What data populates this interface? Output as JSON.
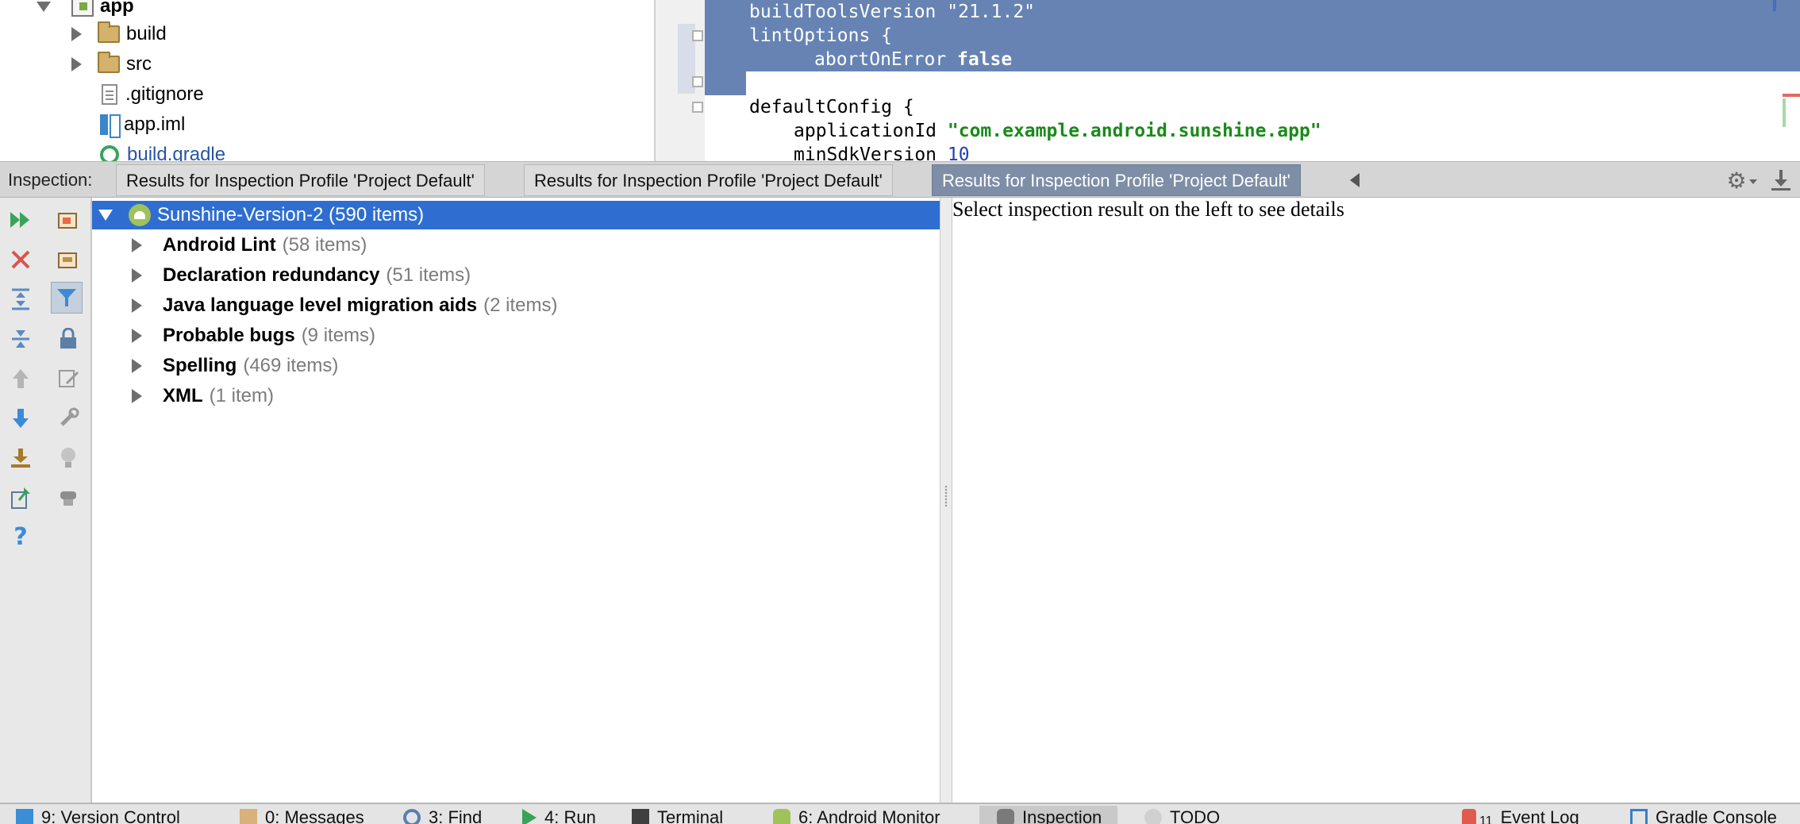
{
  "project_tree": {
    "items": [
      {
        "label": "app",
        "expanded": true,
        "kind": "module"
      },
      {
        "label": "build",
        "expanded": false,
        "kind": "folder"
      },
      {
        "label": "src",
        "expanded": false,
        "kind": "folder"
      },
      {
        "label": ".gitignore",
        "kind": "file"
      },
      {
        "label": "app.iml",
        "kind": "iml"
      },
      {
        "label": "build.gradle",
        "kind": "gradle"
      }
    ]
  },
  "editor": {
    "selected_lines": [
      {
        "indent": "    ",
        "key": "buildToolsVersion ",
        "str": "\"21.1.2\""
      },
      {
        "indent": "    ",
        "key": "lintOptions {"
      },
      {
        "indent": "        ",
        "key": "abortOnError ",
        "kw": "false"
      },
      {
        "indent": "    ",
        "key": "}"
      }
    ],
    "lines": [
      {
        "indent": "    ",
        "key": "defaultConfig {"
      },
      {
        "indent": "        ",
        "key": "applicationId ",
        "str": "\"com.example.android.sunshine.app\""
      },
      {
        "indent": "        ",
        "key": "minSdkVersion ",
        "num": "10"
      }
    ]
  },
  "inspection": {
    "label": "Inspection:",
    "tabs": [
      {
        "label": "Results for Inspection Profile 'Project Default'",
        "active": false
      },
      {
        "label": "Results for Inspection Profile 'Project Default'",
        "active": false
      },
      {
        "label": "Results for Inspection Profile 'Project Default'",
        "active": true
      }
    ]
  },
  "results": {
    "root": {
      "label": "Sunshine-Version-2 (590 items)"
    },
    "items": [
      {
        "name": "Android Lint",
        "count": "(58 items)"
      },
      {
        "name": "Declaration redundancy",
        "count": "(51 items)"
      },
      {
        "name": "Java language level migration aids",
        "count": "(2 items)"
      },
      {
        "name": "Probable bugs",
        "count": "(9 items)"
      },
      {
        "name": "Spelling",
        "count": "(469 items)"
      },
      {
        "name": "XML",
        "count": "(1 item)"
      }
    ]
  },
  "details": {
    "text": "Select inspection result on the left to see details"
  },
  "status_bar": {
    "left": [
      {
        "label": "9: Version Control"
      },
      {
        "label": "0: Messages"
      },
      {
        "label": "3: Find"
      },
      {
        "label": "4: Run"
      },
      {
        "label": "Terminal"
      },
      {
        "label": "6: Android Monitor"
      },
      {
        "label": "Inspection",
        "active": true
      },
      {
        "label": "TODO"
      }
    ],
    "right": [
      {
        "label": "Event Log",
        "badge": "11"
      },
      {
        "label": "Gradle Console"
      }
    ]
  },
  "colors": {
    "selection": "#6683b4",
    "tree_selection": "#2f6ed0",
    "active_tab": "#7d8ea6",
    "string": "#1a8a1a",
    "number": "#1f3fb5"
  }
}
